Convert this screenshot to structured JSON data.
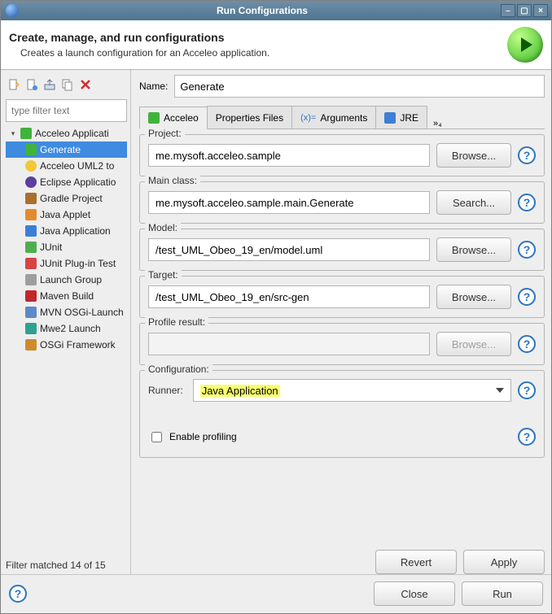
{
  "window": {
    "title": "Run Configurations",
    "header_title": "Create, manage, and run configurations",
    "header_subtitle": "Creates a launch configuration for an Acceleo application."
  },
  "sidebar": {
    "filter_placeholder": "type filter text",
    "status": "Filter matched 14 of 15",
    "root": "Acceleo Applicati",
    "selected": "Generate",
    "items": [
      "Acceleo UML2 to",
      "Eclipse Applicatio",
      "Gradle Project",
      "Java Applet",
      "Java Application",
      "JUnit",
      "JUnit Plug-in Test",
      "Launch Group",
      "Maven Build",
      "MVN OSGi-Launch",
      "Mwe2 Launch",
      "OSGi Framework"
    ]
  },
  "form": {
    "name_label": "Name:",
    "name_value": "Generate",
    "tabs": [
      "Acceleo",
      "Properties Files",
      "Arguments",
      "JRE"
    ],
    "tab_more": "»₄",
    "project_label": "Project:",
    "project_value": "me.mysoft.acceleo.sample",
    "main_label": "Main class:",
    "main_value": "me.mysoft.acceleo.sample.main.Generate",
    "model_label": "Model:",
    "model_value": "/test_UML_Obeo_19_en/model.uml",
    "target_label": "Target:",
    "target_value": "/test_UML_Obeo_19_en/src-gen",
    "profile_label": "Profile result:",
    "profile_value": "",
    "config_label": "Configuration:",
    "runner_label": "Runner:",
    "runner_value": "Java Application",
    "profiling_label": "Enable profiling",
    "btn_browse": "Browse...",
    "btn_search": "Search...",
    "btn_revert": "Revert",
    "btn_apply": "Apply",
    "btn_close": "Close",
    "btn_run": "Run"
  }
}
